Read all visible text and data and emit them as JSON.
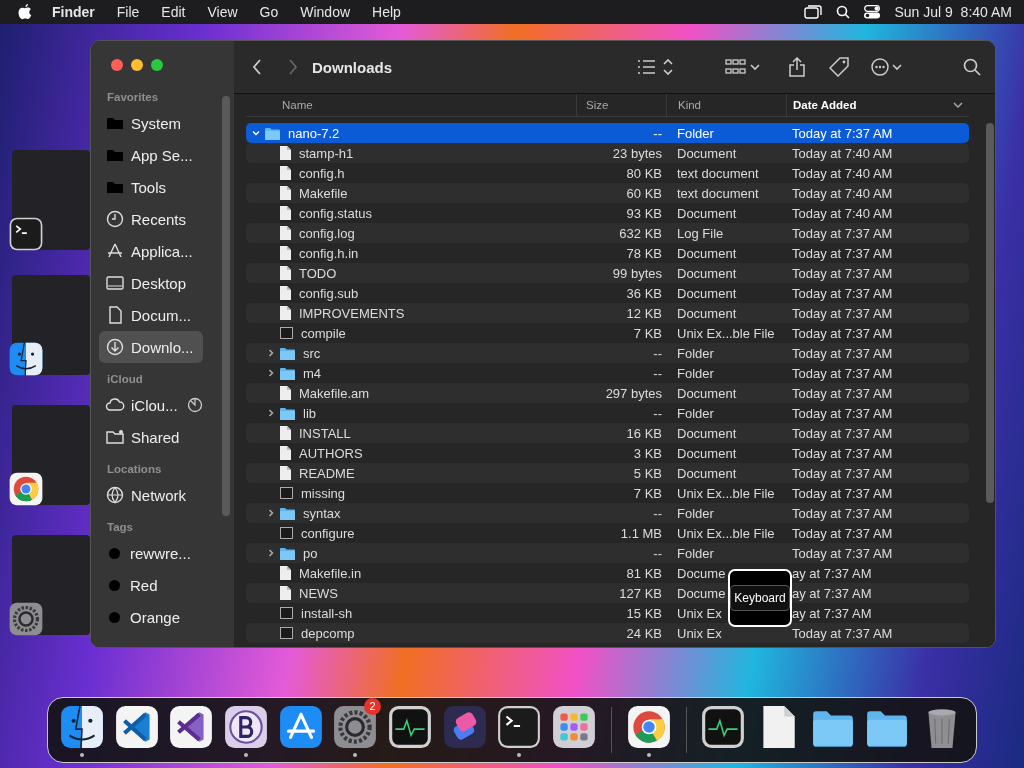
{
  "menu_bar": {
    "app": "Finder",
    "menus": [
      "File",
      "Edit",
      "View",
      "Go",
      "Window",
      "Help"
    ],
    "clock": "Sun Jul 9  8:40 AM"
  },
  "stage_manager": [
    {
      "kind": "terminal"
    },
    {
      "kind": "finder"
    },
    {
      "kind": "chrome"
    },
    {
      "kind": "settings"
    }
  ],
  "window": {
    "title": "Downloads",
    "sidebar": [
      {
        "heading": "Favorites",
        "items": [
          {
            "label": "System",
            "kind": "folder",
            "selected": false
          },
          {
            "label": "App Se...",
            "kind": "folder",
            "selected": false
          },
          {
            "label": "Tools",
            "kind": "folder",
            "selected": false
          },
          {
            "label": "Recents",
            "kind": "clock",
            "selected": false
          },
          {
            "label": "Applica...",
            "kind": "apps",
            "selected": false
          },
          {
            "label": "Desktop",
            "kind": "desktop",
            "selected": false
          },
          {
            "label": "Docum...",
            "kind": "doc",
            "selected": false
          },
          {
            "label": "Downlo...",
            "kind": "download",
            "selected": true
          }
        ]
      },
      {
        "heading": "iCloud",
        "items": [
          {
            "label": "iClou...",
            "kind": "cloud",
            "selected": false,
            "syncing": true
          },
          {
            "label": "Shared",
            "kind": "shared",
            "selected": false
          }
        ]
      },
      {
        "heading": "Locations",
        "items": [
          {
            "label": "Network",
            "kind": "globe",
            "selected": false
          }
        ]
      },
      {
        "heading": "Tags",
        "items": [
          {
            "label": "rewwre...",
            "kind": "tag",
            "color": "#000000",
            "selected": false
          },
          {
            "label": "Red",
            "kind": "tag",
            "color": "#000000",
            "selected": false
          },
          {
            "label": "Orange",
            "kind": "tag",
            "color": "#000000",
            "selected": false
          }
        ]
      }
    ],
    "columns": [
      {
        "label": "Name",
        "sorted": false
      },
      {
        "label": "Size",
        "sorted": false
      },
      {
        "label": "Kind",
        "sorted": false
      },
      {
        "label": "Date Added",
        "sorted": true
      }
    ],
    "rows": [
      {
        "name": "nano-7.2",
        "size": "--",
        "kind_label": "Folder",
        "date": "Today at 7:37 AM",
        "kind": "folder",
        "expanded": true,
        "selected": true,
        "children": [
          {
            "name": "stamp-h1",
            "size": "23 bytes",
            "kind_label": "Document",
            "date": "Today at 7:40 AM",
            "kind": "doc",
            "selected": false
          },
          {
            "name": "config.h",
            "size": "80 KB",
            "kind_label": "text document",
            "date": "Today at 7:40 AM",
            "kind": "doc",
            "selected": false
          },
          {
            "name": "Makefile",
            "size": "60 KB",
            "kind_label": "text document",
            "date": "Today at 7:40 AM",
            "kind": "doc",
            "selected": false
          },
          {
            "name": "config.status",
            "size": "93 KB",
            "kind_label": "Document",
            "date": "Today at 7:40 AM",
            "kind": "doc",
            "selected": false
          },
          {
            "name": "config.log",
            "size": "632 KB",
            "kind_label": "Log File",
            "date": "Today at 7:37 AM",
            "kind": "doc",
            "selected": false
          },
          {
            "name": "config.h.in",
            "size": "78 KB",
            "kind_label": "Document",
            "date": "Today at 7:37 AM",
            "kind": "doc",
            "selected": false
          },
          {
            "name": "TODO",
            "size": "99 bytes",
            "kind_label": "Document",
            "date": "Today at 7:37 AM",
            "kind": "doc",
            "selected": false
          },
          {
            "name": "config.sub",
            "size": "36 KB",
            "kind_label": "Document",
            "date": "Today at 7:37 AM",
            "kind": "doc",
            "selected": false
          },
          {
            "name": "IMPROVEMENTS",
            "size": "12 KB",
            "kind_label": "Document",
            "date": "Today at 7:37 AM",
            "kind": "doc",
            "selected": false
          },
          {
            "name": "compile",
            "size": "7 KB",
            "kind_label": "Unix Ex...ble File",
            "date": "Today at 7:37 AM",
            "kind": "exec",
            "selected": false
          },
          {
            "name": "src",
            "size": "--",
            "kind_label": "Folder",
            "date": "Today at 7:37 AM",
            "kind": "folder",
            "expanded": false,
            "selected": false
          },
          {
            "name": "m4",
            "size": "--",
            "kind_label": "Folder",
            "date": "Today at 7:37 AM",
            "kind": "folder",
            "expanded": false,
            "selected": false
          },
          {
            "name": "Makefile.am",
            "size": "297 bytes",
            "kind_label": "Document",
            "date": "Today at 7:37 AM",
            "kind": "doc",
            "selected": false
          },
          {
            "name": "lib",
            "size": "--",
            "kind_label": "Folder",
            "date": "Today at 7:37 AM",
            "kind": "folder",
            "expanded": false,
            "selected": false
          },
          {
            "name": "INSTALL",
            "size": "16 KB",
            "kind_label": "Document",
            "date": "Today at 7:37 AM",
            "kind": "doc",
            "selected": false
          },
          {
            "name": "AUTHORS",
            "size": "3 KB",
            "kind_label": "Document",
            "date": "Today at 7:37 AM",
            "kind": "doc",
            "selected": false
          },
          {
            "name": "README",
            "size": "5 KB",
            "kind_label": "Document",
            "date": "Today at 7:37 AM",
            "kind": "doc",
            "selected": false
          },
          {
            "name": "missing",
            "size": "7 KB",
            "kind_label": "Unix Ex...ble File",
            "date": "Today at 7:37 AM",
            "kind": "exec",
            "selected": false
          },
          {
            "name": "syntax",
            "size": "--",
            "kind_label": "Folder",
            "date": "Today at 7:37 AM",
            "kind": "folder",
            "expanded": false,
            "selected": false
          },
          {
            "name": "configure",
            "size": "1.1 MB",
            "kind_label": "Unix Ex...ble File",
            "date": "Today at 7:37 AM",
            "kind": "exec",
            "selected": false
          },
          {
            "name": "po",
            "size": "--",
            "kind_label": "Folder",
            "date": "Today at 7:37 AM",
            "kind": "folder",
            "expanded": false,
            "selected": false
          },
          {
            "name": "Makefile.in",
            "size": "81 KB",
            "kind_label": "Docume",
            "date": "ay at 7:37 AM",
            "kind": "doc",
            "selected": false
          },
          {
            "name": "NEWS",
            "size": "127 KB",
            "kind_label": "Docume",
            "date": "ay at 7:37 AM",
            "kind": "doc",
            "selected": false
          },
          {
            "name": "install-sh",
            "size": "15 KB",
            "kind_label": "Unix Ex",
            "date": "ay at 7:37 AM",
            "kind": "exec",
            "selected": false
          },
          {
            "name": "depcomp",
            "size": "24 KB",
            "kind_label": "Unix Ex",
            "date": "Today at 7:37 AM",
            "kind": "exec",
            "selected": false
          }
        ]
      }
    ],
    "tooltip": "Keyboard"
  },
  "dock": [
    {
      "kind": "finder",
      "running": true
    },
    {
      "kind": "vscode",
      "running": false
    },
    {
      "kind": "vs",
      "running": false
    },
    {
      "kind": "bbedit",
      "running": true
    },
    {
      "kind": "appstore",
      "running": false
    },
    {
      "kind": "settings",
      "running": true,
      "badge": "2"
    },
    {
      "kind": "activity",
      "running": false
    },
    {
      "kind": "shortcuts",
      "running": false
    },
    {
      "kind": "terminal",
      "running": true
    },
    {
      "kind": "launchpad",
      "running": false
    },
    {
      "kind": "separator"
    },
    {
      "kind": "chrome",
      "running": true
    },
    {
      "kind": "separator"
    },
    {
      "kind": "activity",
      "running": false
    },
    {
      "kind": "file",
      "running": false
    },
    {
      "kind": "folder",
      "running": false
    },
    {
      "kind": "folder",
      "running": false
    },
    {
      "kind": "trash",
      "running": false
    }
  ]
}
